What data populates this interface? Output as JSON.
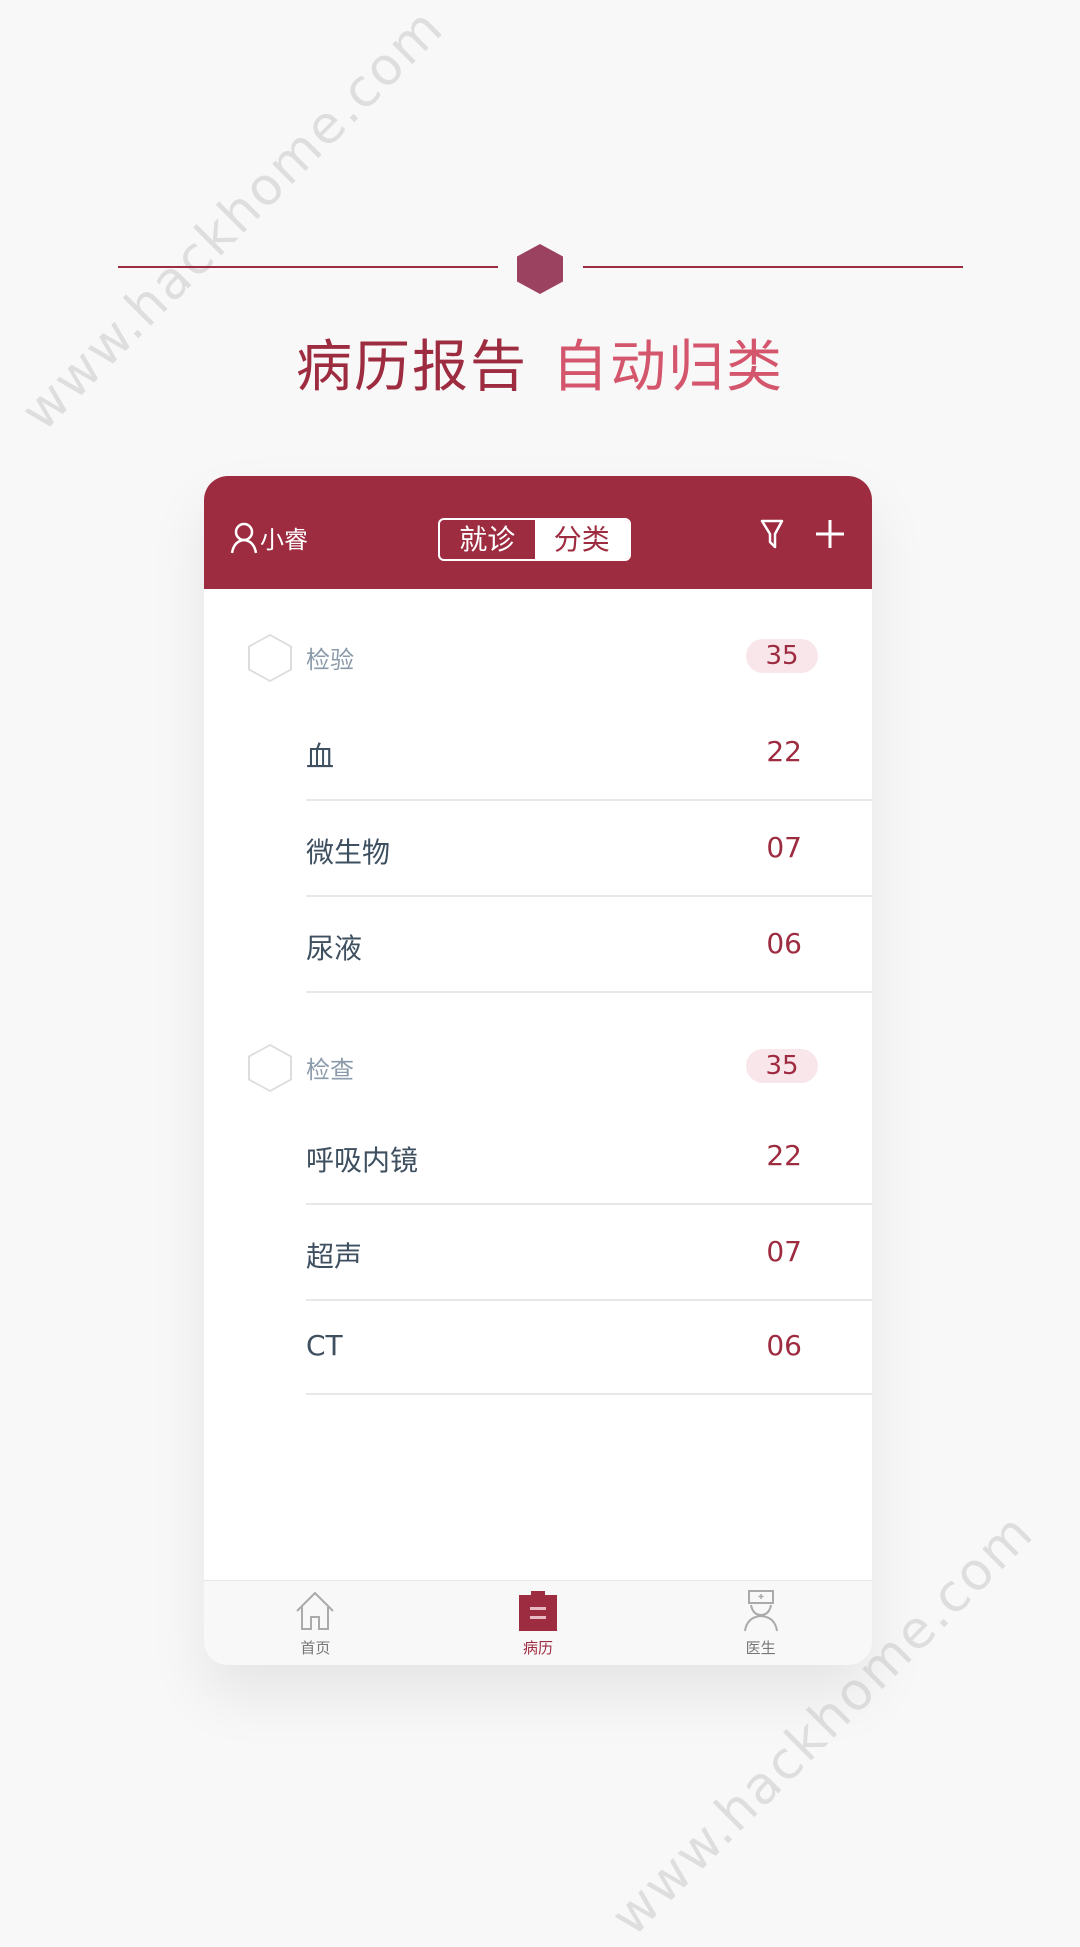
{
  "watermark": "www.hackhome.com",
  "headline": {
    "part1": "病历报告",
    "part2": "自动归类"
  },
  "colors": {
    "primary": "#9e2c40",
    "accent": "#d4566c",
    "badge_bg": "#f9e6ea"
  },
  "header": {
    "user_name": "小睿",
    "segments": [
      "就诊",
      "分类"
    ],
    "active_segment": "分类",
    "filter_icon": "filter-icon",
    "add_icon": "plus-icon"
  },
  "sections": [
    {
      "label": "检验",
      "count": "35",
      "items": [
        {
          "name": "血",
          "count": "22"
        },
        {
          "name": "微生物",
          "count": "07"
        },
        {
          "name": "尿液",
          "count": "06"
        }
      ]
    },
    {
      "label": "检查",
      "count": "35",
      "items": [
        {
          "name": "呼吸内镜",
          "count": "22"
        },
        {
          "name": "超声",
          "count": "07"
        },
        {
          "name": "CT",
          "count": "06"
        }
      ]
    }
  ],
  "tabbar": [
    {
      "label": "首页",
      "icon": "home-icon"
    },
    {
      "label": "病历",
      "icon": "clipboard-icon",
      "active": true
    },
    {
      "label": "医生",
      "icon": "doctor-icon"
    }
  ]
}
